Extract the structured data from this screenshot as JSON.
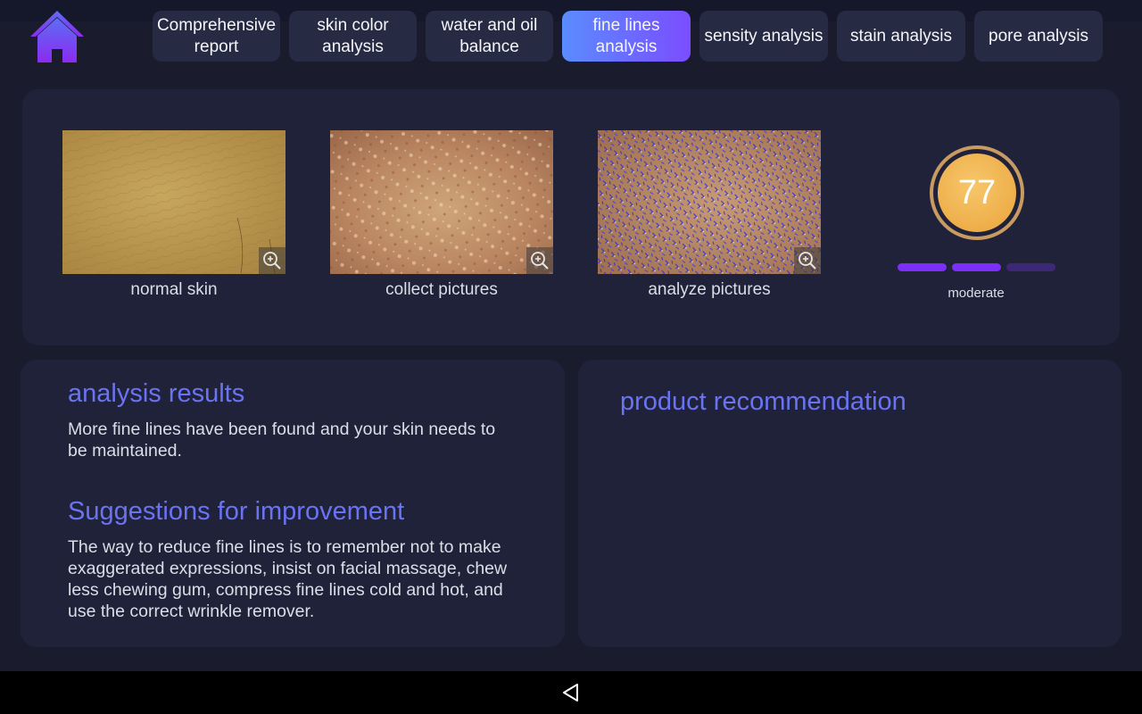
{
  "nav": {
    "home_icon": "home-icon",
    "tabs": [
      {
        "label": "Comprehensive report",
        "active": false
      },
      {
        "label": "skin color analysis",
        "active": false
      },
      {
        "label": "water and oil balance",
        "active": false
      },
      {
        "label": "fine lines analysis",
        "active": true
      },
      {
        "label": "sensity analysis",
        "active": false
      },
      {
        "label": "stain analysis",
        "active": false
      },
      {
        "label": "pore analysis",
        "active": false
      }
    ]
  },
  "images": [
    {
      "label": "normal skin",
      "zoom_icon": "zoom-in-icon"
    },
    {
      "label": "collect pictures",
      "zoom_icon": "zoom-in-icon"
    },
    {
      "label": "analyze pictures",
      "zoom_icon": "zoom-in-icon"
    }
  ],
  "score": {
    "value": "77",
    "level": "moderate",
    "segments_filled": 2,
    "segments_total": 3
  },
  "analysis": {
    "results_title": "analysis results",
    "results_text": "More fine lines have been found and your skin needs to be maintained.",
    "suggestions_title": "Suggestions for improvement",
    "suggestions_text": "The way to reduce fine lines is to remember not to make exaggerated expressions, insist on facial massage, chew less chewing gum, compress fine lines cold and hot, and use the correct wrinkle remover."
  },
  "product": {
    "title": "product recommendation"
  },
  "system_nav": {
    "back_icon": "back-triangle-icon"
  },
  "colors": {
    "background": "#1a1c2e",
    "card": "#20223a",
    "tab": "#272a43",
    "active_tab_start": "#5a8cff",
    "active_tab_end": "#7b4dff",
    "heading": "#6a73f2",
    "score_ring": "#c99a62",
    "score_fill": "#eeae4a",
    "segment_filled": "#7b2ff7",
    "segment_empty": "#3d2878"
  }
}
